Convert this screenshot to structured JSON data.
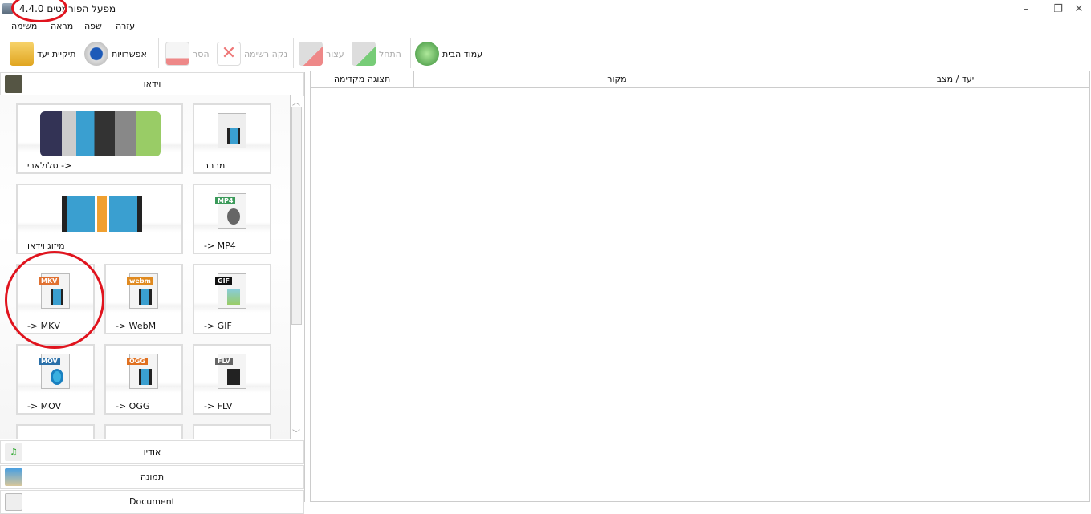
{
  "window": {
    "title": "מפעל הפורמטים 4.4.0",
    "minimize": "–",
    "restore": "❐",
    "close": "✕"
  },
  "menu": [
    "משימה",
    "מראה",
    "שפה",
    "עזרה"
  ],
  "toolbar": {
    "output_folder": "תיקיית יעד",
    "options": "אפשרויות",
    "remove": "הסר",
    "clear_list": "נקה רשימה",
    "stop": "עצור",
    "start": "התחל",
    "homepage": "עמוד הבית"
  },
  "categories": {
    "video": "וידאו",
    "audio": "אודיו",
    "image": "תמונה",
    "document": "Document"
  },
  "tiles": [
    {
      "label": "סלולארי ->"
    },
    {
      "label": "מרבב"
    },
    {
      "label": "מיזוג וידאו"
    },
    {
      "label": "-> MP4",
      "tag": "MP4"
    },
    {
      "label": "-> MKV",
      "tag": "MKV"
    },
    {
      "label": "-> WebM",
      "tag": "webm"
    },
    {
      "label": "-> GIF",
      "tag": "GIF"
    },
    {
      "label": "-> MOV",
      "tag": "MOV"
    },
    {
      "label": "-> OGG",
      "tag": "OGG"
    },
    {
      "label": "-> FLV",
      "tag": "FLV"
    }
  ],
  "table": {
    "columns": [
      "תצוגה מקדימה",
      "מקור",
      "יעד / מצב"
    ]
  },
  "colors": {
    "annotation": "#e0141e",
    "accent_green": "#3a8f3a"
  }
}
